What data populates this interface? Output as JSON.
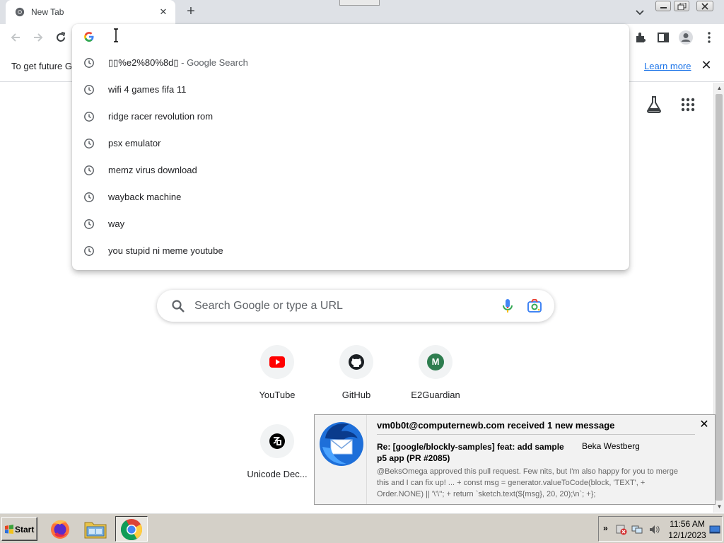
{
  "browser": {
    "tab_title": "New Tab",
    "tab_close": "✕",
    "new_tab": "+",
    "icons": [
      "chrome-icon",
      "back-icon",
      "forward-icon",
      "reload-icon",
      "extensions-icon",
      "side-panel-icon",
      "profile-icon",
      "menu-icon"
    ]
  },
  "infobar": {
    "message": "To get future G",
    "learn_more": "Learn more",
    "close": "✕"
  },
  "omnibox": {
    "suggestions": [
      {
        "text": "▯▯%e2%80%8d▯",
        "suffix": " - Google Search"
      },
      {
        "text": "wifi 4 games fifa 11"
      },
      {
        "text": "ridge racer revolution rom"
      },
      {
        "text": "psx emulator"
      },
      {
        "text": "memz virus download"
      },
      {
        "text": "wayback machine"
      },
      {
        "text": "way"
      },
      {
        "text": "you stupid ni meme youtube"
      }
    ]
  },
  "ntp": {
    "search_placeholder": "Search Google or type a URL",
    "shortcuts": [
      {
        "label": "YouTube",
        "icon": "youtube-icon"
      },
      {
        "label": "GitHub",
        "icon": "github-icon"
      },
      {
        "label": "E2Guardian",
        "icon": "letter-avatar-icon",
        "letter": "M"
      },
      {
        "label": "Unicode Dec...",
        "icon": "unicode-icon"
      }
    ]
  },
  "notification": {
    "header": "vm0b0t@computernewb.com received 1 new message",
    "subject": "Re: [google/blockly-samples] feat: add sample p5 app (PR #2085)",
    "from": "Beka Westberg",
    "body": "@BeksOmega approved this pull request. Few nits, but I'm also happy for you to merge this and I can fix up! ... + const msg = generator.valueToCode(block, 'TEXT', + Order.NONE) || '\\'\\''; + return `sketch.text(${msg}, 20, 20);\\n`; +};",
    "close": "✕"
  },
  "taskbar": {
    "start_label": "Start",
    "time": "11:56 AM",
    "date": "12/1/2023",
    "tray_chevron": "»"
  },
  "colors": {
    "tabstrip": "#dee1e6",
    "link": "#1a73e8",
    "youtube_red": "#ff0000",
    "e2guardian_green": "#2e7d4f",
    "taskbar": "#d4d0c8"
  }
}
